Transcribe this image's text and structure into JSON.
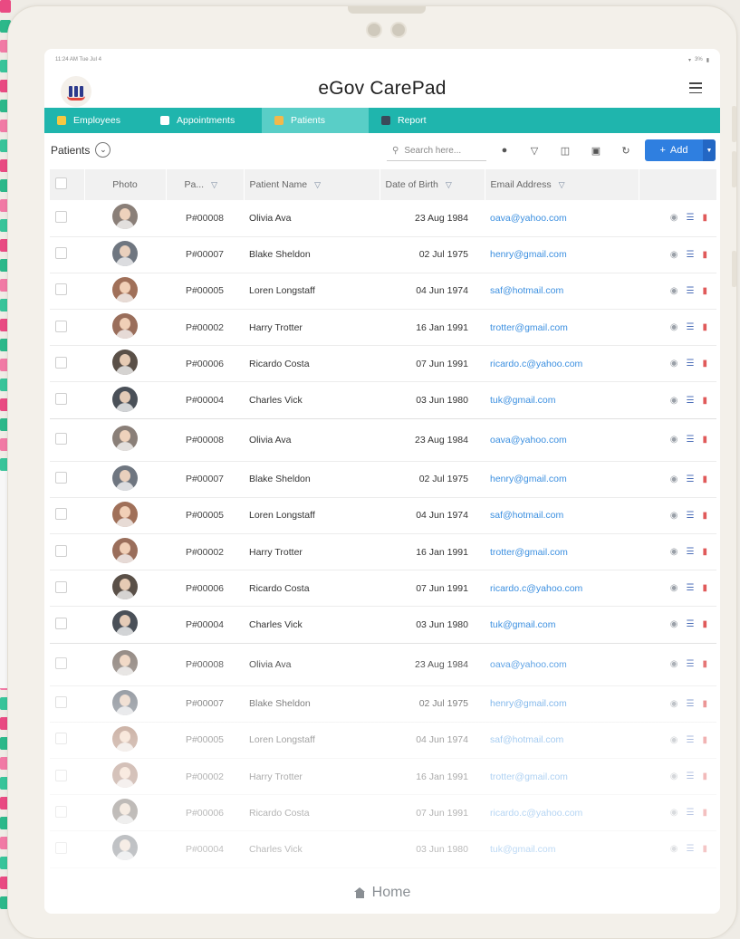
{
  "status_bar": {
    "time": "11:24 AM  Tue Jul 4",
    "battery": "3%",
    "wifi_icon": "wifi-icon",
    "battery_icon": "battery-icon"
  },
  "app": {
    "title": "eGov CarePad",
    "logo_icon": "columns-logo-icon",
    "menu_icon": "hamburger-icon"
  },
  "tabs": [
    {
      "label": "Employees",
      "icon": "employees-icon",
      "active": false,
      "color": "#f5c842"
    },
    {
      "label": "Appointments",
      "icon": "calendar-icon",
      "active": false,
      "color": "#ffffff"
    },
    {
      "label": "Patients",
      "icon": "patients-icon",
      "active": true,
      "color": "#f2b84b"
    },
    {
      "label": "Report",
      "icon": "report-icon",
      "active": false,
      "color": "#3a4a5a"
    }
  ],
  "grid": {
    "title": "Patients",
    "search_placeholder": "Search here...",
    "add_label": "Add",
    "toolbar_icons": [
      "globe-icon",
      "filter-icon",
      "columns-icon",
      "lock-icon",
      "refresh-icon"
    ]
  },
  "table": {
    "columns": [
      {
        "label": "",
        "filter": false
      },
      {
        "label": "Photo",
        "filter": false
      },
      {
        "label": "Pa...",
        "filter": true
      },
      {
        "label": "Patient Name",
        "filter": true
      },
      {
        "label": "Date of Birth",
        "filter": true
      },
      {
        "label": "Email Address",
        "filter": true
      },
      {
        "label": "",
        "filter": false
      }
    ],
    "rows": [
      {
        "id": "P#00008",
        "name": "Olivia Ava",
        "dob": "23 Aug 1984",
        "email": "oava@yahoo.com",
        "avatar_color": "#8a7f78"
      },
      {
        "id": "P#00007",
        "name": "Blake Sheldon",
        "dob": "02 Jul 1975",
        "email": "henry@gmail.com",
        "avatar_color": "#6f7680"
      },
      {
        "id": "P#00005",
        "name": "Loren Longstaff",
        "dob": "04 Jun 1974",
        "email": "saf@hotmail.com",
        "avatar_color": "#a07059"
      },
      {
        "id": "P#00002",
        "name": "Harry Trotter",
        "dob": "16 Jan 1991",
        "email": "trotter@gmail.com",
        "avatar_color": "#9a6e5b"
      },
      {
        "id": "P#00006",
        "name": "Ricardo Costa",
        "dob": "07 Jun 1991",
        "email": "ricardo.c@yahoo.com",
        "avatar_color": "#5a5048"
      },
      {
        "id": "P#00004",
        "name": "Charles Vick",
        "dob": "03 Jun 1980",
        "email": "tuk@gmail.com",
        "avatar_color": "#4a5058"
      },
      {
        "id": "P#00008",
        "name": "Olivia Ava",
        "dob": "23 Aug 1984",
        "email": "oava@yahoo.com",
        "avatar_color": "#8a7f78"
      },
      {
        "id": "P#00007",
        "name": "Blake Sheldon",
        "dob": "02 Jul 1975",
        "email": "henry@gmail.com",
        "avatar_color": "#6f7680"
      },
      {
        "id": "P#00005",
        "name": "Loren Longstaff",
        "dob": "04 Jun 1974",
        "email": "saf@hotmail.com",
        "avatar_color": "#a07059"
      },
      {
        "id": "P#00002",
        "name": "Harry Trotter",
        "dob": "16 Jan 1991",
        "email": "trotter@gmail.com",
        "avatar_color": "#9a6e5b"
      },
      {
        "id": "P#00006",
        "name": "Ricardo Costa",
        "dob": "07 Jun 1991",
        "email": "ricardo.c@yahoo.com",
        "avatar_color": "#5a5048"
      },
      {
        "id": "P#00004",
        "name": "Charles Vick",
        "dob": "03 Jun 1980",
        "email": "tuk@gmail.com",
        "avatar_color": "#4a5058"
      },
      {
        "id": "P#00008",
        "name": "Olivia Ava",
        "dob": "23 Aug 1984",
        "email": "oava@yahoo.com",
        "avatar_color": "#8a7f78"
      },
      {
        "id": "P#00007",
        "name": "Blake Sheldon",
        "dob": "02 Jul 1975",
        "email": "henry@gmail.com",
        "avatar_color": "#6f7680"
      },
      {
        "id": "P#00005",
        "name": "Loren Longstaff",
        "dob": "04 Jun 1974",
        "email": "saf@hotmail.com",
        "avatar_color": "#a07059"
      },
      {
        "id": "P#00002",
        "name": "Harry Trotter",
        "dob": "16 Jan 1991",
        "email": "trotter@gmail.com",
        "avatar_color": "#9a6e5b"
      },
      {
        "id": "P#00006",
        "name": "Ricardo Costa",
        "dob": "07 Jun 1991",
        "email": "ricardo.c@yahoo.com",
        "avatar_color": "#5a5048"
      },
      {
        "id": "P#00004",
        "name": "Charles Vick",
        "dob": "03 Jun 1980",
        "email": "tuk@gmail.com",
        "avatar_color": "#4a5058"
      }
    ],
    "row_action_icons": [
      "view-icon",
      "edit-icon",
      "delete-icon"
    ]
  },
  "home": {
    "label": "Home",
    "icon": "home-icon"
  },
  "colors": {
    "accent": "#1fb5ad",
    "tab_active": "#59cec7",
    "primary_button": "#2f7fe0",
    "email_link": "#3b8fe0",
    "delete": "#e05a5a"
  },
  "decorations": {
    "strip_colors": [
      "#e94a82",
      "#2cb88a",
      "#f17aa5",
      "#38c49a",
      "#e94a82",
      "#2cb88a",
      "#f17aa5",
      "#38c49a"
    ]
  }
}
